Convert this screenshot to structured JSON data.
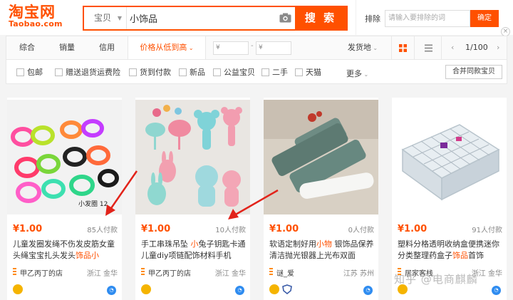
{
  "logo": {
    "cn": "淘宝网",
    "en": "Taobao.com"
  },
  "search": {
    "category": "宝贝",
    "query": "小饰品",
    "button": "搜 索"
  },
  "exclude": {
    "label": "排除",
    "placeholder": "请输入要排除的词",
    "confirm": "确定",
    "close": "×"
  },
  "sort": {
    "items": [
      "综合",
      "销量",
      "信用",
      "价格从低到高"
    ],
    "price_min": "¥",
    "price_max": "¥",
    "dash": "-",
    "ship_from": "发货地",
    "page_current": "1/100"
  },
  "filters": {
    "items": [
      "包邮",
      "赠送退货运费险",
      "货到付款",
      "新品",
      "公益宝贝",
      "二手",
      "天猫"
    ],
    "more": "更多",
    "merge": "合并同款宝贝"
  },
  "products": [
    {
      "price": "¥1.00",
      "sales": "85人付款",
      "title_pre": "儿童发圈发绳不伤发皮筋女童头绳宝宝扎头发头",
      "title_hl": "饰品小",
      "title_post": "",
      "shop": "甲乙丙丁的店",
      "location": "浙江 金华",
      "img_caption": "小发圈 12"
    },
    {
      "price": "¥1.00",
      "sales": "10人付款",
      "title_pre": "手工串珠吊坠 ",
      "title_hl": "小",
      "title_post": "兔子钥匙卡通 儿童diy项链配饰材料手机",
      "shop": "甲乙丙丁的店",
      "location": "浙江 金华",
      "img_caption": ""
    },
    {
      "price": "¥1.00",
      "sales": "0人付款",
      "title_pre": "软语定制好用",
      "title_hl": "小物",
      "title_post": " 银饰品保养清洁抛光银器上光布双面",
      "shop": "谜_爱",
      "location": "江苏 苏州",
      "img_caption": ""
    },
    {
      "price": "¥1.00",
      "sales": "91人付款",
      "title_pre": "塑料分格透明收纳盒便携迷你分类整理药盒子",
      "title_hl": "饰品",
      "title_post": "首饰",
      "shop": "居家客栈",
      "location": "浙江 金华",
      "img_caption": ""
    }
  ],
  "watermark": "知乎 @电商麒麟",
  "colors": {
    "accent": "#ff5000"
  }
}
